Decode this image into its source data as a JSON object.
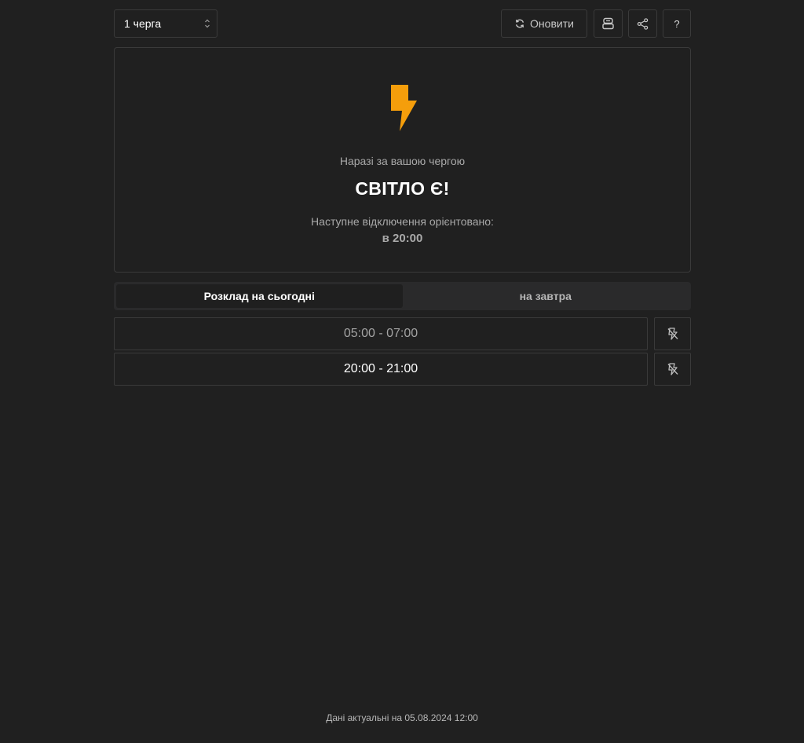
{
  "header": {
    "queue_select": {
      "value": "1 черга"
    },
    "refresh_label": "Оновити",
    "help_label": "?"
  },
  "status": {
    "icon": "lightning-bolt-icon",
    "icon_color": "#f59e0b",
    "intro": "Наразі за вашою чергою",
    "main": "СВІТЛО Є!",
    "next_label": "Наступне відключення орієнтовано:",
    "next_time": "в 20:00"
  },
  "tabs": [
    {
      "label": "Розклад на сьогодні",
      "active": true
    },
    {
      "label": "на завтра",
      "active": false
    }
  ],
  "schedule": [
    {
      "time": "05:00 - 07:00",
      "past": true
    },
    {
      "time": "20:00 - 21:00",
      "past": false
    }
  ],
  "footer": {
    "text": "Дані актуальні на 05.08.2024 12:00"
  }
}
